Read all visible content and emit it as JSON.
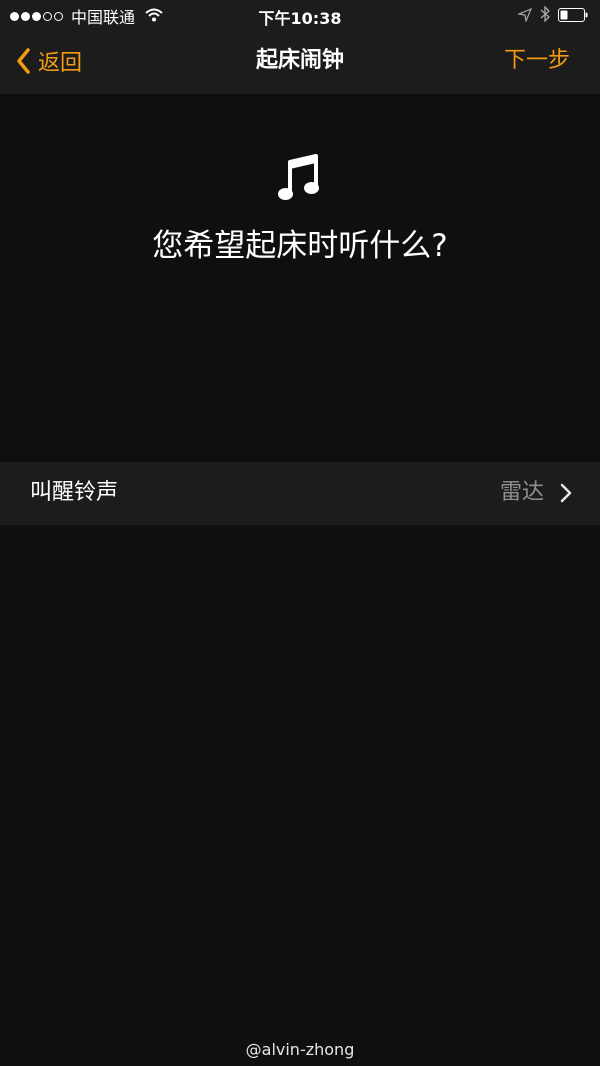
{
  "status_bar": {
    "carrier": "中国联通",
    "time": "下午10:38",
    "signal_bars_filled": 3,
    "signal_bars_total": 5,
    "icons": [
      "signal-dots-icon",
      "wifi-icon",
      "location-arrow-icon",
      "bluetooth-icon",
      "battery-icon"
    ]
  },
  "nav": {
    "back_label": "返回",
    "title": "起床闹钟",
    "next_label": "下一步",
    "accent_color": "#f39c12"
  },
  "content": {
    "icon": "music-note-icon",
    "prompt": "您希望起床时听什么?"
  },
  "settings": {
    "rows": [
      {
        "label": "叫醒铃声",
        "value": "雷达"
      }
    ]
  },
  "watermark": "@alvin-zhong",
  "colors": {
    "background": "#0f0f0f",
    "bar_background": "#1c1c1c",
    "secondary_text": "#8e8e93"
  }
}
